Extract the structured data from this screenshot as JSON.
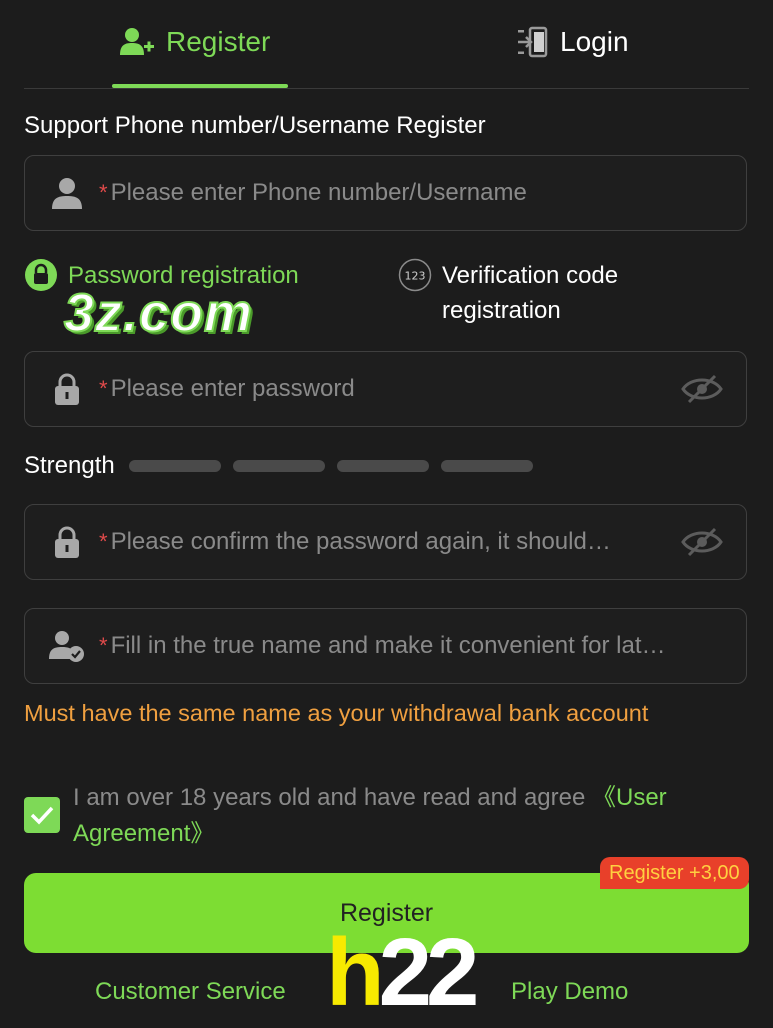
{
  "tabs": {
    "register": "Register",
    "login": "Login"
  },
  "form": {
    "section_label": "Support Phone number/Username Register",
    "required_mark": "*",
    "username": {
      "placeholder": "Please enter Phone number/Username"
    },
    "password": {
      "placeholder": "Please enter password"
    },
    "confirm": {
      "placeholder": "Please confirm the password again, it should…"
    },
    "real_name": {
      "placeholder": "Fill in the true name and make it convenient for lat…"
    }
  },
  "modes": {
    "password": "Password registration",
    "verification": "Verification code registration",
    "verification_badge": "123"
  },
  "watermark": "3z.com",
  "strength": {
    "label": "Strength",
    "levels": 4
  },
  "warning": "Must have the same name as your withdrawal bank account",
  "agreement": {
    "checked": true,
    "text": "I am over 18 years old and have read and agree ",
    "link": "《User Agreement》"
  },
  "register_button": "Register",
  "bonus_badge": "Register +3,00",
  "footer": {
    "customer_service": "Customer Service",
    "play_demo": "Play Demo"
  },
  "logo": {
    "h": "h",
    "num": "22"
  },
  "colors": {
    "accent": "#7ed957",
    "background": "#1c1c1c",
    "warning": "#f0a040",
    "required": "#e04a4a",
    "badge": "#e8402a"
  }
}
